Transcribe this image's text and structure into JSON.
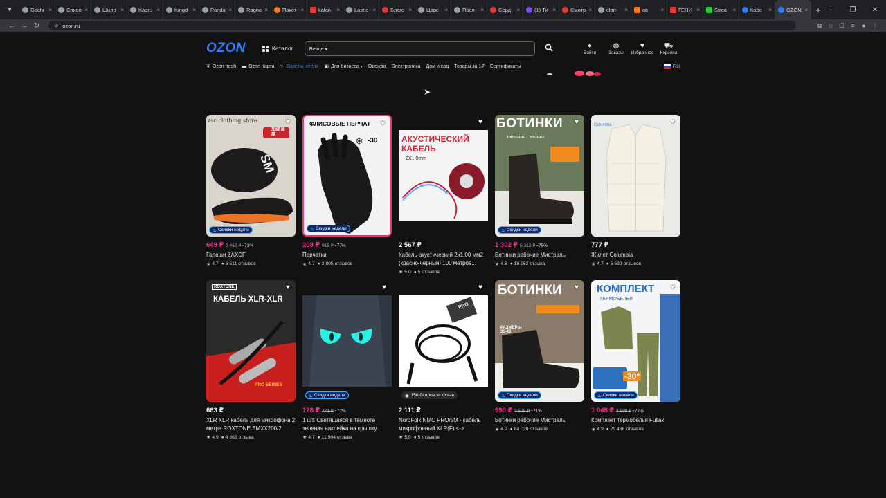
{
  "browser": {
    "tabs": [
      {
        "label": "Gachi"
      },
      {
        "label": "Списо"
      },
      {
        "label": "Шило"
      },
      {
        "label": "Kaoru"
      },
      {
        "label": "Kingd"
      },
      {
        "label": "Panda"
      },
      {
        "label": "Ragna"
      },
      {
        "label": "Пакет"
      },
      {
        "label": "kalan"
      },
      {
        "label": "Last e"
      },
      {
        "label": "Благо"
      },
      {
        "label": "Царс"
      },
      {
        "label": "Посл"
      },
      {
        "label": "Серд"
      },
      {
        "label": "(1) Ти"
      },
      {
        "label": "Смотр"
      },
      {
        "label": "clan-"
      },
      {
        "label": "ati"
      },
      {
        "label": "ГЕНИ"
      },
      {
        "label": "Strea"
      },
      {
        "label": "Кабе"
      },
      {
        "label": "OZON",
        "active": true
      }
    ],
    "url": "ozon.ru"
  },
  "header": {
    "logo": "OZON",
    "catalog_label": "Каталог",
    "search_scope": "Везде",
    "icons": [
      {
        "name": "login",
        "label": "Войти",
        "icon": "user-icon"
      },
      {
        "name": "orders",
        "label": "Заказы",
        "icon": "box-icon"
      },
      {
        "name": "favorites",
        "label": "Избранное",
        "icon": "heart-icon"
      },
      {
        "name": "cart",
        "label": "Корзина",
        "icon": "cart-icon"
      }
    ]
  },
  "subnav": {
    "items": [
      {
        "label": "Ozon fresh",
        "icon": "leaf-icon"
      },
      {
        "label": "Ozon Карта",
        "icon": "card-icon"
      },
      {
        "label": "Билеты, отели",
        "icon": "plane-icon",
        "highlight": true
      },
      {
        "label": "Для бизнеса",
        "icon": "briefcase-icon",
        "dropdown": true
      },
      {
        "label": "Одежда"
      },
      {
        "label": "Электроника"
      },
      {
        "label": "Дом и сад"
      },
      {
        "label": "Товары за 1₽"
      },
      {
        "label": "Сертификаты"
      }
    ],
    "lang": "RU"
  },
  "products": [
    {
      "price": "649 ₽",
      "old": "2 463 ₽",
      "discount": "−73%",
      "title": "Галоши ZAXCF",
      "rating": "4.7",
      "reviews": "6 511 отзывов",
      "badge": "Скидки недели",
      "art_text": "SM",
      "art_note": "加绒 加厚",
      "store": "zsc clothing store"
    },
    {
      "price": "208 ₽",
      "old": "915 ₽",
      "discount": "−77%",
      "title": "Перчатки",
      "rating": "4.7",
      "reviews": "2 805 отзывов",
      "badge": "Скидки недели",
      "art_text": "ФЛИСОВЫЕ ПЕРЧАТ",
      "art_note": "-30"
    },
    {
      "price": "2 567 ₽",
      "old": "",
      "discount": "",
      "title": "Кабель акустический 2х1.00 мм2 (красно-черный) 100 метров...",
      "rating": "5.0",
      "reviews": "5 отзывов",
      "badge": "",
      "art_text": "АКУСТИЧЕСКИЙ КАБЕЛЬ",
      "art_note": "2Х1.0mm"
    },
    {
      "price": "1 302 ₽",
      "old": "5 212 ₽",
      "discount": "−75%",
      "title": "Ботинки рабочие Мистраль",
      "rating": "4.8",
      "reviews": "18 952 отзыва",
      "badge": "Скидки недели",
      "art_text": "БОТИНКИ",
      "art_note": "РАБОЧИЕ · ЗИМНИЕ"
    },
    {
      "price": "777 ₽",
      "old": "",
      "discount": "",
      "title": "Жилет Columbia",
      "rating": "4.7",
      "reviews": "6 599 отзывов",
      "badge": "",
      "art_text": "Columbia",
      "art_note": ""
    },
    {
      "price": "663 ₽",
      "old": "",
      "discount": "",
      "title": "XLR XLR кабель для микрофона 2 метра ROXTONE SMXX200/2",
      "rating": "4.9",
      "reviews": "4 863 отзыва",
      "badge": "",
      "art_text": "КАБЕЛЬ XLR-XLR",
      "art_note": "PRO SERIES",
      "brand": "ROXTONE"
    },
    {
      "price": "128 ₽",
      "old": "471 ₽",
      "discount": "−72%",
      "title": "1 шт. Светящаяся в темноте зеленая наклейка на крышку...",
      "rating": "4.7",
      "reviews": "11 904 отзыва",
      "badge": "Скидки недели",
      "art_text": "",
      "art_note": ""
    },
    {
      "price": "2 111 ₽",
      "old": "",
      "discount": "",
      "title": "NordFolk NMC PRO/5M - кабель микрофонный XLR(F) <-> XLR(M)...",
      "rating": "5.0",
      "reviews": "5 отзывов",
      "badge": "150 баллов за отзыв",
      "badge_type": "points",
      "art_text": "PRO",
      "art_note": ""
    },
    {
      "price": "990 ₽",
      "old": "3 525 ₽",
      "discount": "−71%",
      "title": "Ботинки рабочие Мистраль",
      "rating": "4.9",
      "reviews": "84 028 отзывов",
      "badge": "Скидки недели",
      "art_text": "БОТИНКИ",
      "art_note": "РАЗМЕРЫ 35-48"
    },
    {
      "price": "1 048 ₽",
      "old": "4 599 ₽",
      "discount": "−77%",
      "title": "Комплект термобелья Fullax",
      "rating": "4.9",
      "reviews": "29 436 отзывов",
      "badge": "Скидки недели",
      "art_text": "КОМПЛЕКТ",
      "art_note": "ТЕРМОБЕЛЬЯ",
      "art_extra": "-30°"
    }
  ]
}
